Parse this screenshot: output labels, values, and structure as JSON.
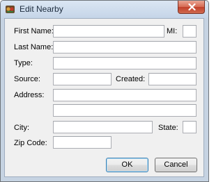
{
  "window": {
    "title": "Edit Nearby"
  },
  "labels": {
    "first_name": "First Name:",
    "mi": "MI:",
    "last_name": "Last Name:",
    "type": "Type:",
    "source": "Source:",
    "created": "Created:",
    "address": "Address:",
    "city": "City:",
    "state": "State:",
    "zip_code": "Zip Code:"
  },
  "fields": {
    "first_name": "",
    "mi": "",
    "last_name": "",
    "type": "",
    "source": "",
    "created": "",
    "address_line1": "",
    "address_line2": "",
    "city": "",
    "state": "",
    "zip_code": ""
  },
  "buttons": {
    "ok": "OK",
    "cancel": "Cancel"
  },
  "colors": {
    "close_button": "#d66a53",
    "title_bar": "#c5d5e8",
    "dialog_face": "#f0f0f0"
  }
}
